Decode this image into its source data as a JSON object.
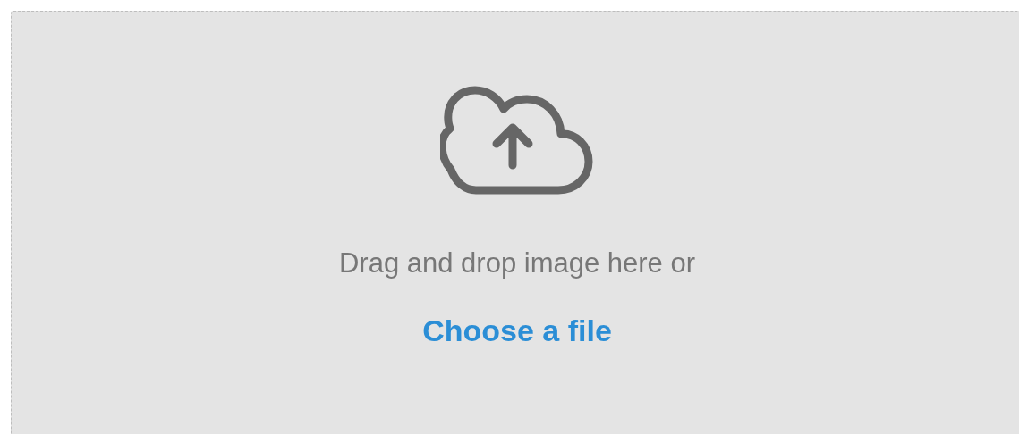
{
  "dropzone": {
    "prompt": "Drag and drop image here or",
    "link": "Choose a file"
  }
}
